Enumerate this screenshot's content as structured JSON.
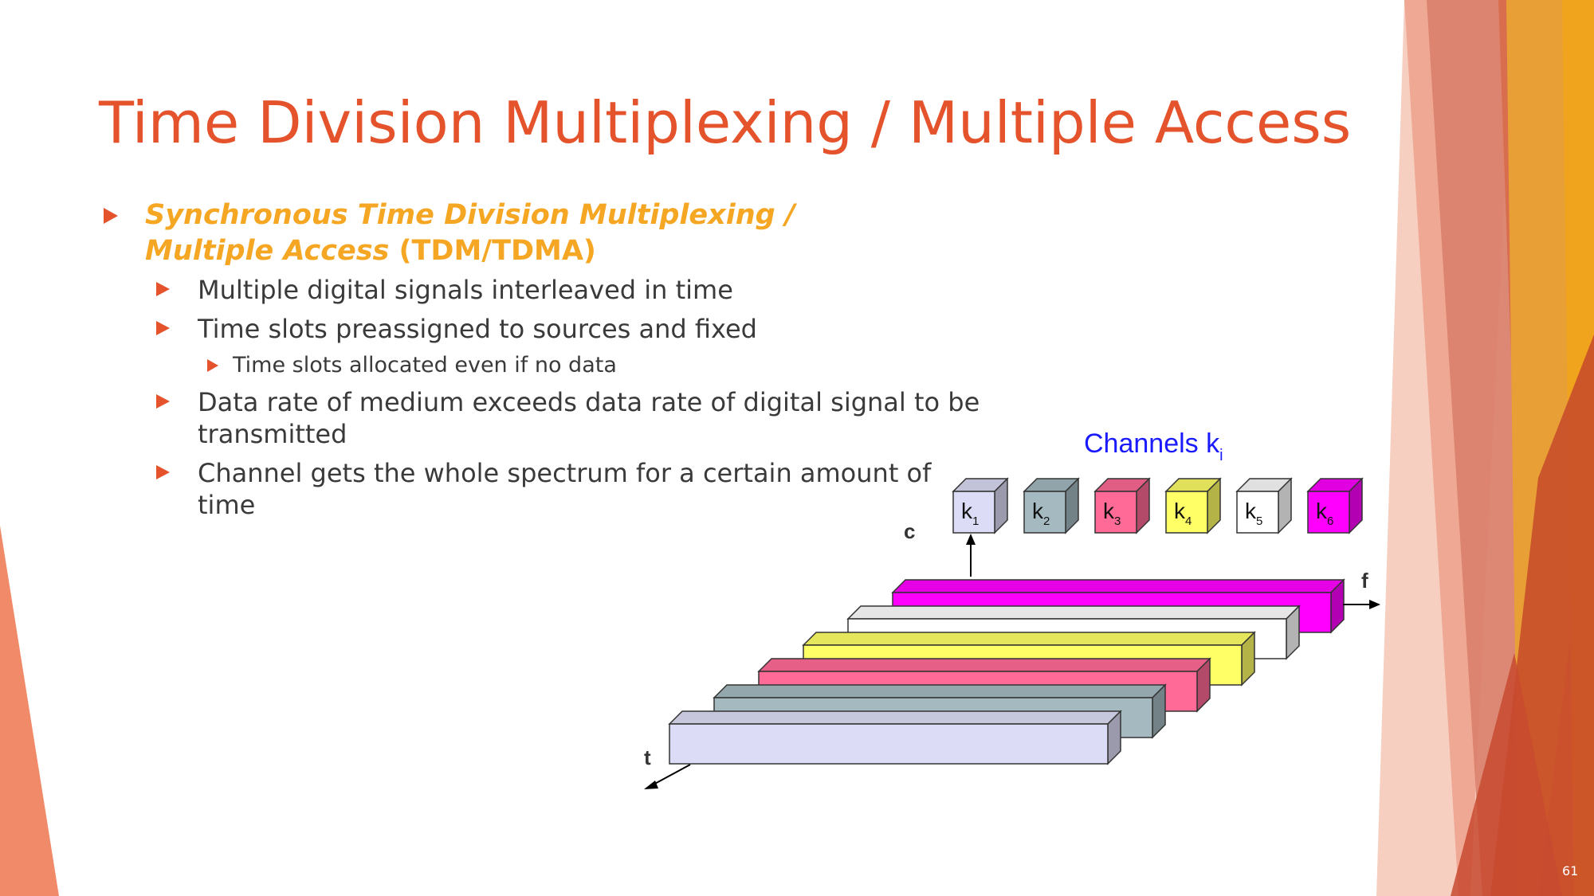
{
  "slide": {
    "title": "Time Division Multiplexing / Multiple Access",
    "page_number": "61"
  },
  "bullets": {
    "main_italic": "Synchronous Time Division Multiplexing / Multiple Access",
    "main_suffix": " (TDM/TDMA)",
    "sub1": "Multiple digital signals interleaved in time",
    "sub2": "Time slots preassigned to sources and fixed",
    "sub2_1": "Time slots allocated even if no data",
    "sub3": "Data rate of medium exceeds data rate of digital signal to be transmitted",
    "sub4": "Channel gets the whole spectrum for a certain amount of time"
  },
  "diagram": {
    "title_main": "Channels k",
    "title_sub": "i",
    "axis_c": "c",
    "axis_f": "f",
    "axis_t": "t",
    "channels": [
      {
        "letter": "k",
        "index": "1",
        "color": "#dcdcf6"
      },
      {
        "letter": "k",
        "index": "2",
        "color": "#a4bac0"
      },
      {
        "letter": "k",
        "index": "3",
        "color": "#ff6a96"
      },
      {
        "letter": "k",
        "index": "4",
        "color": "#ffff66"
      },
      {
        "letter": "k",
        "index": "5",
        "color": "#ffffff"
      },
      {
        "letter": "k",
        "index": "6",
        "color": "#ff00ff"
      }
    ]
  },
  "colors": {
    "title": "#e4532b",
    "accent": "#f5a623",
    "diagram_title": "#1a1aff"
  }
}
